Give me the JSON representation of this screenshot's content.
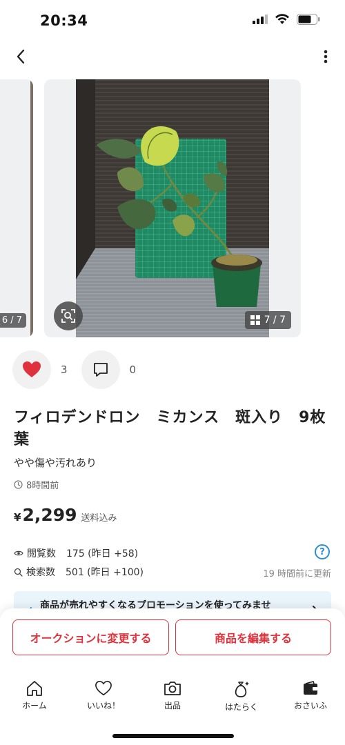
{
  "status": {
    "time": "20:34"
  },
  "gallery": {
    "prev_counter": "6 / 7",
    "counter": "7 / 7"
  },
  "social": {
    "like_count": "3",
    "comment_count": "0"
  },
  "item": {
    "title": "フィロデンドロン　ミカンス　斑入り　9枚葉",
    "condition": "やや傷や汚れあり",
    "posted": "8時間前",
    "currency": "¥",
    "price": "2,299",
    "shipping": "送料込み"
  },
  "stats": {
    "views_label": "閲覧数",
    "views_value": "175 (昨日 +58)",
    "search_label": "検索数",
    "search_value": "501 (昨日 +100)",
    "help": "?",
    "updated": "19 時間前に更新"
  },
  "promo": {
    "text": "商品が売れやすくなるプロモーションを使ってみませ"
  },
  "buttons": {
    "auction": "オークションに変更する",
    "edit": "商品を編集する"
  },
  "tabs": [
    {
      "label": "ホーム",
      "icon": "home-icon"
    },
    {
      "label": "いいね！",
      "icon": "heart-icon"
    },
    {
      "label": "出品",
      "icon": "camera-icon"
    },
    {
      "label": "はたらく",
      "icon": "money-bag-icon"
    },
    {
      "label": "おさいふ",
      "icon": "wallet-icon"
    }
  ],
  "colors": {
    "accent": "#e0323c",
    "link": "#2b8fd6",
    "like": "#e0323c",
    "promo_bg": "#eaf4fb"
  }
}
